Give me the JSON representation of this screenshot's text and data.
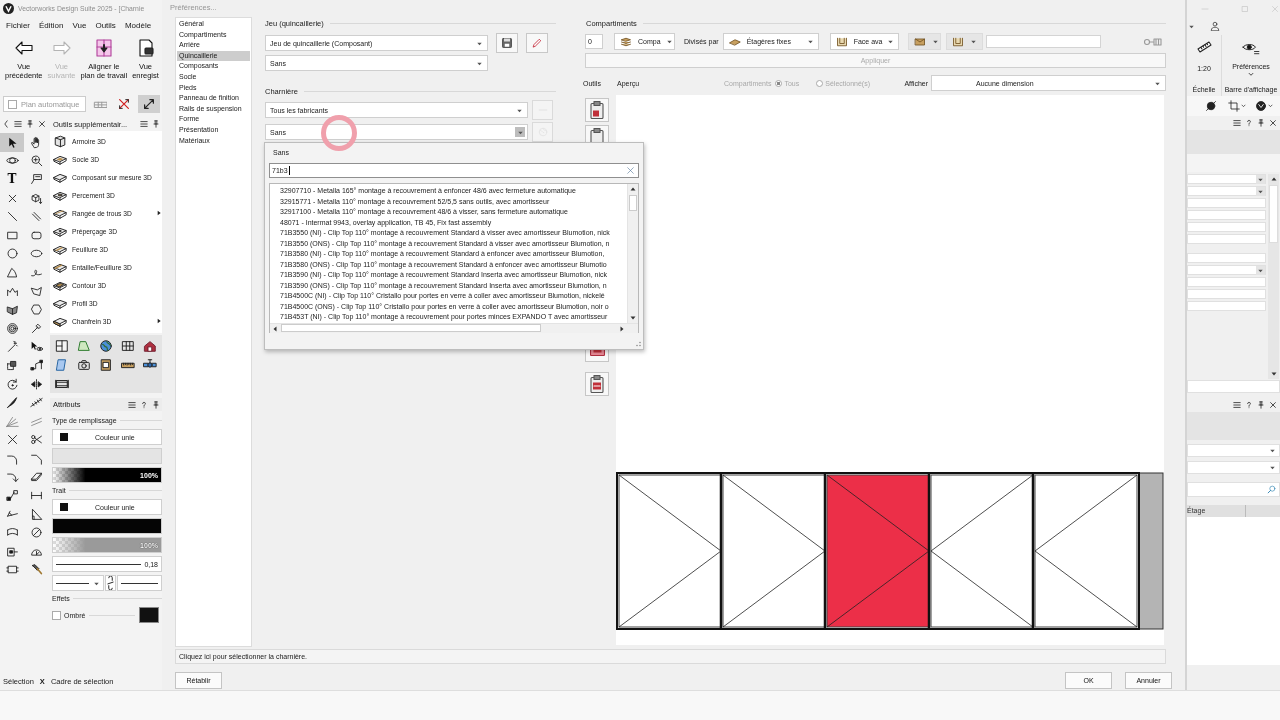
{
  "app": {
    "title": "Vectorworks Design Suite 2025 - [Charnie",
    "menu": [
      "Fichier",
      "Édition",
      "Vue",
      "Outils",
      "Modèle"
    ],
    "toolbar": [
      {
        "kind": "back",
        "lines": [
          "Vue",
          "précédente"
        ],
        "disabled": false
      },
      {
        "kind": "forward",
        "lines": [
          "Vue",
          "suivante"
        ],
        "disabled": true
      },
      {
        "kind": "align",
        "lines": [
          "Aligner le",
          "plan de travail"
        ],
        "disabled": false
      },
      {
        "kind": "saved-view",
        "lines": [
          "Vue",
          "enregist"
        ],
        "disabled": false
      }
    ],
    "view_bar": {
      "auto_plane": {
        "label": "Plan automatique",
        "checked": false
      },
      "toggles": [
        {
          "on": false
        },
        {
          "on": false
        },
        {
          "on": true
        }
      ]
    },
    "tools": [
      {
        "selected": true
      },
      {
        "selected": false
      },
      {
        "selected": false
      },
      {
        "selected": false
      },
      {
        "glyph": "T",
        "selected": false
      },
      {
        "selected": false
      },
      {
        "selected": false
      },
      {
        "selected": false
      },
      {
        "selected": false
      },
      {
        "selected": false
      },
      {
        "selected": false
      },
      {
        "selected": false
      },
      {
        "selected": false
      },
      {
        "selected": false
      },
      {
        "selected": false
      },
      {
        "selected": false
      },
      {
        "selected": false
      },
      {
        "selected": false
      },
      {
        "selected": false
      },
      {
        "selected": false
      },
      {
        "selected": false
      },
      {
        "selected": false
      },
      {
        "selected": false
      },
      {
        "selected": false
      },
      {
        "selected": false
      },
      {
        "selected": false
      },
      {
        "selected": false
      },
      {
        "selected": false
      },
      {
        "selected": false
      },
      {
        "selected": false
      },
      {
        "selected": false
      },
      {
        "selected": false
      },
      {
        "selected": false
      },
      {
        "selected": false
      },
      {
        "selected": false
      },
      {
        "selected": false
      },
      {
        "selected": false
      },
      {
        "selected": false
      },
      {
        "selected": false
      },
      {
        "selected": false
      },
      {
        "selected": false
      },
      {
        "selected": false
      },
      {
        "selected": false
      },
      {
        "selected": false
      },
      {
        "selected": false
      },
      {
        "selected": false
      },
      {
        "selected": false
      },
      {
        "selected": false
      }
    ],
    "extra_tools": {
      "title": "Outils supplémentair...",
      "items": [
        {
          "label": "Armoire 3D",
          "submenu": false
        },
        {
          "label": "Socle 3D",
          "submenu": false
        },
        {
          "label": "Composant sur mesure 3D",
          "submenu": false
        },
        {
          "label": "Percement 3D",
          "submenu": false
        },
        {
          "label": "Rangée de trous 3D",
          "submenu": true
        },
        {
          "label": "Préperçage 3D",
          "submenu": false
        },
        {
          "label": "Feuillure 3D",
          "submenu": false
        },
        {
          "label": "Entaille/Feuillure 3D",
          "submenu": false
        },
        {
          "label": "Contour 3D",
          "submenu": false
        },
        {
          "label": "Profil 3D",
          "submenu": false
        },
        {
          "label": "Chanfrein 3D",
          "submenu": true
        }
      ]
    },
    "attributes": {
      "title": "Attributs",
      "fill_label": "Type de remplissage",
      "fill": "Couleur unie",
      "fill_opacity": {
        "level": 1,
        "reading": "100%"
      },
      "stroke_label": "Trait",
      "stroke": "Couleur unie",
      "stroke_opacity": {
        "level": 1,
        "reading": "100%"
      },
      "line_weight": "0,18",
      "effects_label": "Effets",
      "shadow": {
        "label": "Ombré",
        "checked": false
      }
    },
    "status_bar": {
      "mode": "Sélection",
      "key": "X",
      "hint": "Cadre de sélection"
    }
  },
  "dialog": {
    "title": "Préférences...",
    "nav": [
      {
        "label": "Général",
        "selected": false
      },
      {
        "label": "Compartiments",
        "selected": false
      },
      {
        "label": "Arrière",
        "selected": false
      },
      {
        "label": "Quincaillerie",
        "selected": true
      },
      {
        "label": "Composants",
        "selected": false
      },
      {
        "label": "Socle",
        "selected": false
      },
      {
        "label": "Pieds",
        "selected": false
      },
      {
        "label": "Panneau de finition",
        "selected": false
      },
      {
        "label": "Rails de suspension",
        "selected": false
      },
      {
        "label": "Forme",
        "selected": false
      },
      {
        "label": "Présentation",
        "selected": false
      },
      {
        "label": "Matériaux",
        "selected": false
      }
    ],
    "hardware_set": {
      "title": "Jeu (quincaillerie)",
      "set": "Jeu de quincaillerie (Composant)",
      "variant": "Sans",
      "buttons": [
        {
          "kind": "save",
          "disabled": false
        },
        {
          "kind": "edit",
          "disabled": false
        }
      ]
    },
    "hinge": {
      "title": "Charnière",
      "manufacturer": "Tous les fabricants",
      "model": "Sans",
      "buttons": [
        {
          "kind": "remove",
          "disabled": true
        },
        {
          "kind": "globe",
          "disabled": true
        }
      ]
    },
    "hinge_picker": {
      "label": "Sans",
      "search": "71b3",
      "results": [
        "32907710 - Metalla 165° montage à recouvrement à enfoncer 48/6 avec fermeture automatique",
        "32915771 - Metalla 110° montage à recouvrement 52/5,5 sans outils, avec amortisseur",
        "32917100 - Metalla 110° montage à recouvrement 48/6 à visser, sans fermeture automatique",
        "48071 - Intermat 9943, overlay application, TB 45, Fix fast assembly",
        "71B3550 (NI) - Clip Top 110° montage à recouvrement Standard à visser avec amortisseur Blumotion, nick",
        "71B3550 (ONS) - Clip Top 110° montage à recouvrement Standard à visser avec amortisseur Blumotion, n",
        "71B3580 (NI) - Clip Top 110° montage à recouvrement Standard à enfoncer avec amortisseur Blumotion,",
        "71B3580 (ONS) - Clip Top 110° montage à recouvrement Standard à enfoncer avec amortisseur Blumotio",
        "71B3590 (NI) - Clip Top 110° montage à recouvrement Standard Inserta avec amortisseur Blumotion, nick",
        "71B3590 (ONS) - Clip Top 110° montage à recouvrement Standard Inserta avec amortisseur Blumotion, n",
        "71B4500C (NI) - Clip Top 110° Cristallo pour portes en verre à coller avec amortisseur Blumotion, nickelé",
        "71B4500C (ONS) - Clip Top 110° Cristallo pour portes en verre à coller avec amortisseur Blumotion, noir o",
        "71B453T (NI) - Clip Top 110° montage à recouvrement pour portes minces EXPANDO T avec amortisseur"
      ]
    },
    "compartments": {
      "title": "Compartiments",
      "count": "0",
      "type": "Compa",
      "divided_by_label": "Divisés par",
      "divider": "Étagères fixes",
      "front": "Face ava",
      "icon_selectors": [
        {
          "disabled": true
        },
        {
          "disabled": true
        }
      ],
      "apply": {
        "label": "Appliquer",
        "disabled": true
      }
    },
    "tools_label": "Outils",
    "preview_label": "Aperçu",
    "scope": {
      "label": "Compartiments",
      "disabled": true,
      "options": [
        {
          "label": "Tous",
          "selected": true
        },
        {
          "label": "Sélectionné(s)",
          "selected": false
        }
      ]
    },
    "display": {
      "label": "Afficher",
      "value": "Aucune dimension"
    },
    "preview": {
      "doors": [
        {
          "kind": "apex-right",
          "selected": false
        },
        {
          "kind": "apex-right",
          "selected": false
        },
        {
          "kind": "apex-right",
          "selected": true
        },
        {
          "kind": "apex-left",
          "selected": false
        },
        {
          "kind": "apex-left",
          "selected": false
        }
      ]
    },
    "hint": "Cliquez ici pour sélectionner la charnière.",
    "buttons": {
      "reset": "Rétablir",
      "ok": "OK",
      "cancel": "Annuler"
    }
  },
  "right_dock": {
    "scale": "1:20",
    "scale_label": "Échelle",
    "view_prefs": "Préférences",
    "view_bar_label": "Barre d'affichage",
    "table_header": "Étage"
  }
}
